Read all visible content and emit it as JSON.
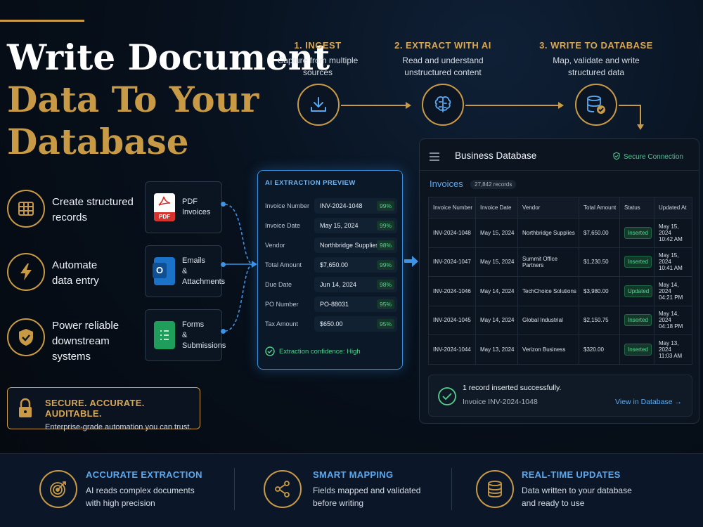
{
  "title": {
    "line1": "Write Document",
    "line2": "Data To Your",
    "line3": "Database"
  },
  "steps": [
    {
      "heading": "1. INGEST",
      "desc1": "Capture from multiple",
      "desc2": "sources",
      "icon": "download-icon"
    },
    {
      "heading": "2. EXTRACT WITH AI",
      "desc1": "Read and understand",
      "desc2": "unstructured content",
      "icon": "brain-icon"
    },
    {
      "heading": "3. WRITE TO DATABASE",
      "desc1": "Map, validate and write",
      "desc2": "structured data",
      "icon": "database-check-icon"
    }
  ],
  "features": [
    {
      "line1": "Create structured",
      "line2": "records",
      "line3": "",
      "icon": "grid-icon"
    },
    {
      "line1": "Automate",
      "line2": "data entry",
      "line3": "",
      "icon": "lightning-icon"
    },
    {
      "line1": "Power reliable",
      "line2": "downstream",
      "line3": "systems",
      "icon": "shield-check-icon"
    }
  ],
  "sources": [
    {
      "line1": "PDF",
      "line2": "Invoices",
      "badge": "PDF",
      "icon": "pdf-icon"
    },
    {
      "line1": "Emails",
      "line2": "& Attachments",
      "badge": "O",
      "icon": "outlook-icon"
    },
    {
      "line1": "Forms",
      "line2": "& Submissions",
      "badge": "",
      "icon": "form-icon"
    }
  ],
  "secure": {
    "heading": "SECURE. ACCURATE. AUDITABLE.",
    "desc": "Enterprise-grade automation you can trust."
  },
  "preview": {
    "title": "AI EXTRACTION PREVIEW",
    "rows": [
      {
        "key": "Invoice Number",
        "value": "INV-2024-1048",
        "conf": "99%"
      },
      {
        "key": "Invoice Date",
        "value": "May 15, 2024",
        "conf": "99%"
      },
      {
        "key": "Vendor",
        "value": "Northbridge Supplies",
        "conf": "98%"
      },
      {
        "key": "Total Amount",
        "value": "$7,650.00",
        "conf": "99%"
      },
      {
        "key": "Due Date",
        "value": "Jun 14, 2024",
        "conf": "98%"
      },
      {
        "key": "PO Number",
        "value": "PO-88031",
        "conf": "95%"
      },
      {
        "key": "Tax Amount",
        "value": "$650.00",
        "conf": "95%"
      }
    ],
    "confidence": "Extraction confidence: High"
  },
  "database": {
    "title": "Business Database",
    "secure": "Secure Connection",
    "section": "Invoices",
    "count": "27,842 records",
    "columns": [
      "Invoice Number",
      "Invoice Date",
      "Vendor",
      "Total Amount",
      "Status",
      "Updated At"
    ],
    "rows": [
      [
        "INV-2024-1048",
        "May 15, 2024",
        "Northbridge Supplies",
        "$7,650.00",
        "Inserted",
        "May 15, 2024",
        "10:42 AM"
      ],
      [
        "INV-2024-1047",
        "May 15, 2024",
        "Summit Office Partners",
        "$1,230.50",
        "Inserted",
        "May 15, 2024",
        "10:41 AM"
      ],
      [
        "INV-2024-1046",
        "May 14, 2024",
        "TechChoice Solutions",
        "$3,980.00",
        "Updated",
        "May 14, 2024",
        "04:21 PM"
      ],
      [
        "INV-2024-1045",
        "May 14, 2024",
        "Global Industrial",
        "$2,150.75",
        "Inserted",
        "May 14, 2024",
        "04:18 PM"
      ],
      [
        "INV-2024-1044",
        "May 13, 2024",
        "Verizon Business",
        "$320.00",
        "Inserted",
        "May 13, 2024",
        "11:03 AM"
      ]
    ],
    "success": {
      "message": "1 record inserted successfully.",
      "detail": "Invoice INV-2024-1048",
      "link": "View in Database →"
    }
  },
  "bottom": [
    {
      "heading": "ACCURATE EXTRACTION",
      "desc1": "AI reads complex documents",
      "desc2": "with high precision",
      "icon": "target-icon"
    },
    {
      "heading": "SMART MAPPING",
      "desc1": "Fields mapped and validated",
      "desc2": "before writing",
      "icon": "nodes-icon"
    },
    {
      "heading": "REAL-TIME UPDATES",
      "desc1": "Data written to your database",
      "desc2": "and ready to use",
      "icon": "database-icon"
    }
  ],
  "colors": {
    "gold": "#c99a45",
    "blue": "#5aa9f0",
    "green": "#53d18c"
  }
}
